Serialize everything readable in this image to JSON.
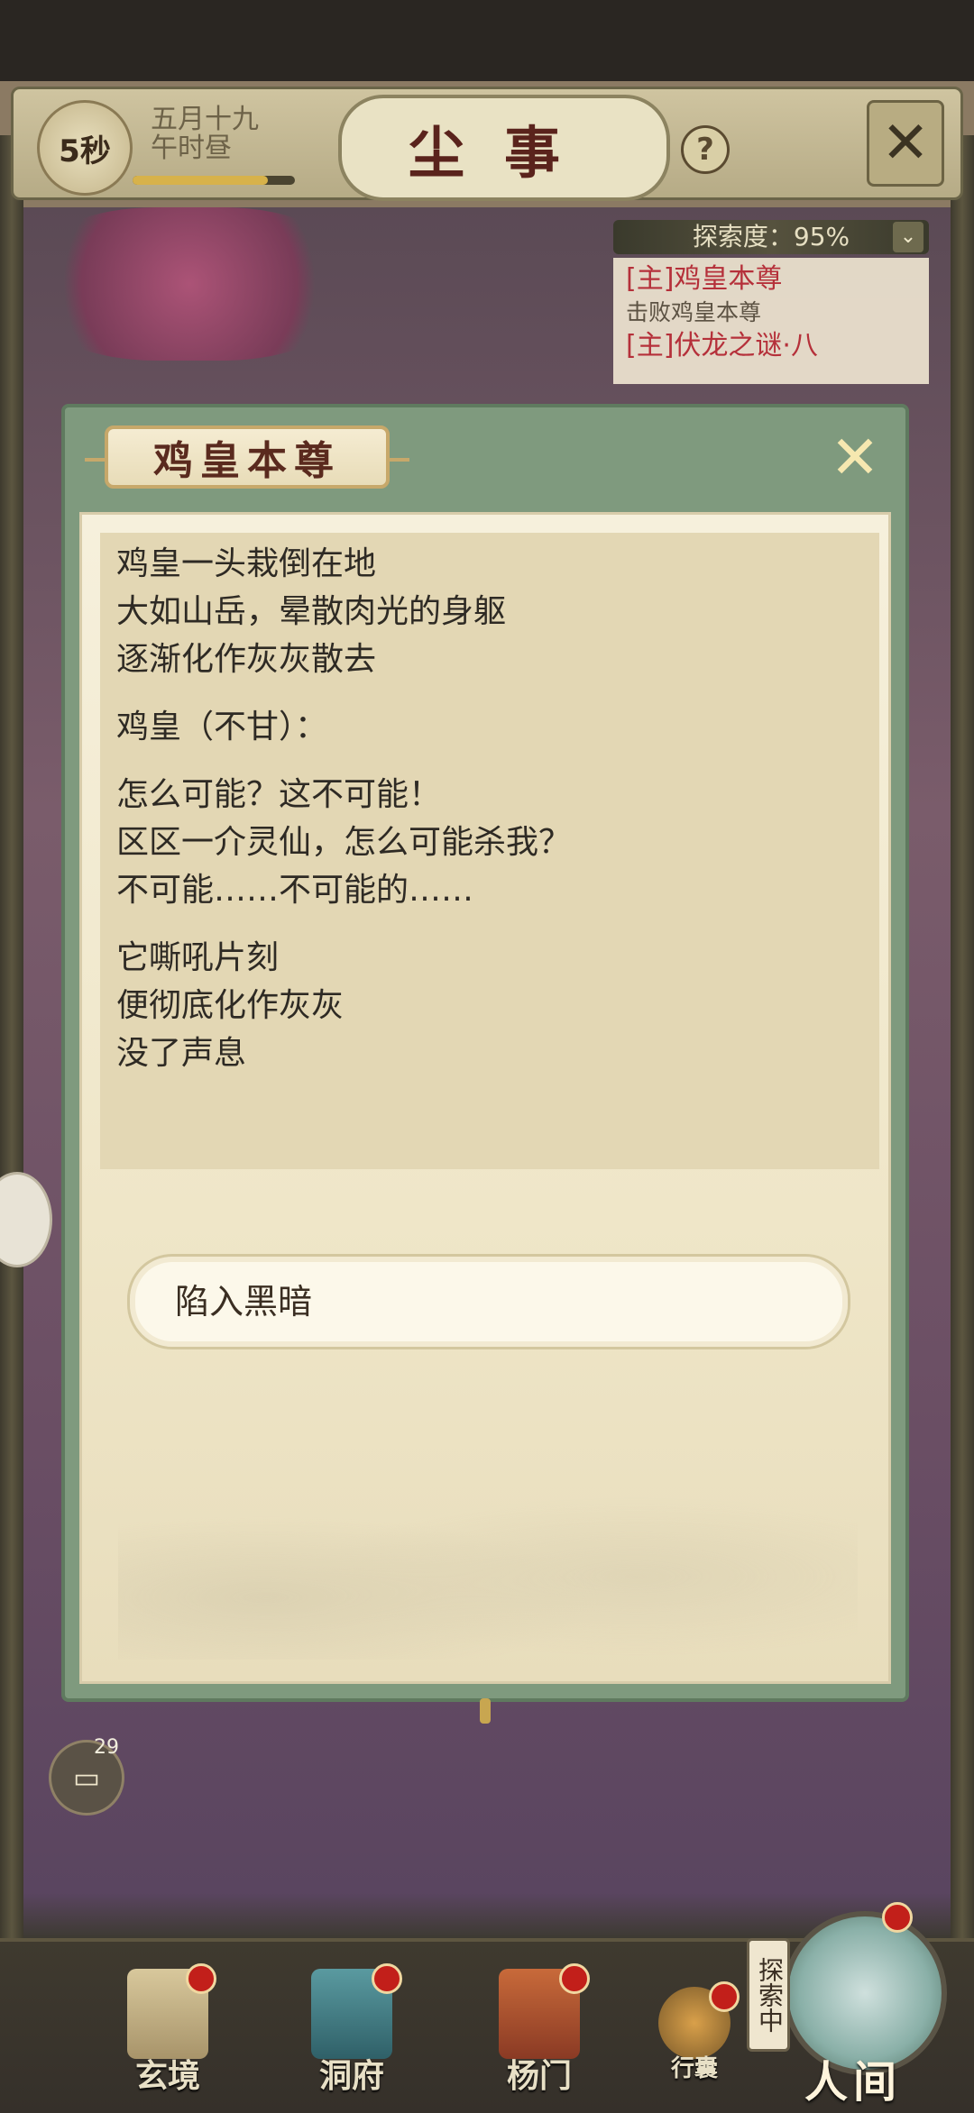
{
  "header": {
    "timer": "5秒",
    "date_line1": "五月十九",
    "date_line2": "午时昼",
    "title": "尘事",
    "help": "?",
    "close": "✕"
  },
  "quest_panel": {
    "explore_label": "探索度：95%",
    "items": [
      {
        "title": "[主]鸡皇本尊",
        "sub": "击败鸡皇本尊"
      },
      {
        "title": "[主]伏龙之谜·八",
        "sub": ""
      }
    ]
  },
  "dialog": {
    "title": "鸡皇本尊",
    "close": "✕",
    "story": {
      "para1": [
        "鸡皇一头栽倒在地",
        "大如山岳，晕散肉光的身躯",
        "逐渐化作灰灰散去"
      ],
      "para2": [
        "鸡皇（不甘）："
      ],
      "para3": [
        "怎么可能？这不可能！",
        "区区一介灵仙，怎么可能杀我？",
        "不可能……不可能的……"
      ],
      "para4": [
        "它嘶吼片刻",
        "便彻底化作灰灰",
        "没了声息"
      ]
    },
    "choice": "陷入黑暗"
  },
  "chat": {
    "count": "29"
  },
  "bottom_nav": {
    "items": [
      {
        "label": "玄境"
      },
      {
        "label": "洞府"
      },
      {
        "label": "杨门"
      },
      {
        "label": "行囊"
      }
    ],
    "explore_tag": "探索中",
    "world": "人间"
  },
  "colors": {
    "accent_red": "#c21f1a",
    "dialog_green": "#7f9a7e",
    "parchment": "#efe6c8"
  }
}
